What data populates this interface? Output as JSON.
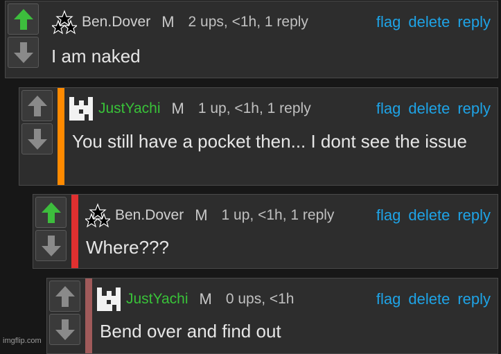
{
  "comments": [
    {
      "username": "Ben.Dover",
      "mod": "M",
      "meta": "2 ups, <1h, 1 reply",
      "text": "I am naked",
      "actions": {
        "flag": "flag",
        "delete": "delete",
        "reply": "reply"
      },
      "upvoted": true,
      "avatar_icon": "star-triangle-icon",
      "stripe_color": ""
    },
    {
      "username": "JustYachi",
      "mod": "M",
      "meta": "1 up, <1h, 1 reply",
      "text": "You still have a pocket then... I dont see the issue",
      "actions": {
        "flag": "flag",
        "delete": "delete",
        "reply": "reply"
      },
      "upvoted": false,
      "avatar_icon": "pixel-block-icon",
      "stripe_color": "#ff8a00"
    },
    {
      "username": "Ben.Dover",
      "mod": "M",
      "meta": "1 up, <1h, 1 reply",
      "text": "Where???",
      "actions": {
        "flag": "flag",
        "delete": "delete",
        "reply": "reply"
      },
      "upvoted": true,
      "avatar_icon": "star-triangle-icon",
      "stripe_color": "#e03030"
    },
    {
      "username": "JustYachi",
      "mod": "M",
      "meta": "0 ups, <1h",
      "text": "Bend over and find out",
      "actions": {
        "flag": "flag",
        "delete": "delete",
        "reply": "reply"
      },
      "upvoted": false,
      "avatar_icon": "pixel-block-icon",
      "stripe_color": "#a05a5a"
    }
  ],
  "colors": {
    "background": "#171717",
    "card": "#2d2d2d",
    "action_link": "#1ea3e6",
    "upvote_active": "#3dbd3d",
    "vote_inactive": "#8a8a8a",
    "username_green": "#39c239"
  },
  "watermark": "imgflip.com"
}
